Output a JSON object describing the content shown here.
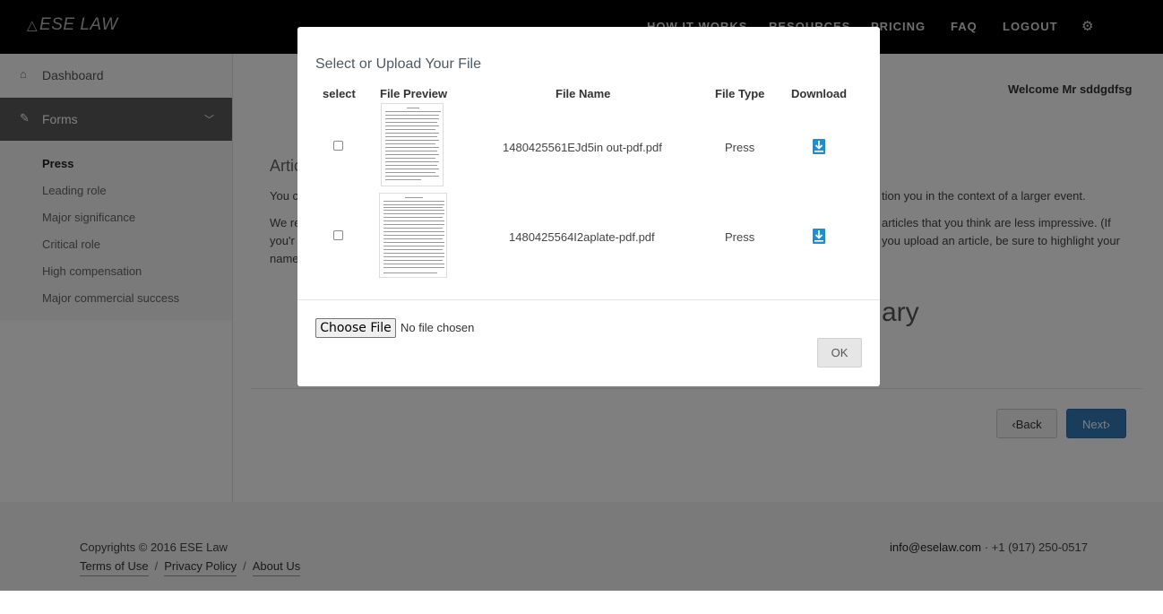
{
  "header": {
    "logo": "ESE LAW",
    "nav": [
      {
        "label": "HOW IT WORKS"
      },
      {
        "label": "RESOURCES"
      },
      {
        "label": "PRICING"
      },
      {
        "label": "FAQ"
      },
      {
        "label": "LOGOUT"
      }
    ],
    "settings_icon": "gears-icon"
  },
  "sidebar": {
    "dashboard": "Dashboard",
    "forms": "Forms",
    "sub_items": [
      {
        "label": "Press",
        "active": true
      },
      {
        "label": "Leading role"
      },
      {
        "label": "Major significance"
      },
      {
        "label": "Critical role"
      },
      {
        "label": "High compensation"
      },
      {
        "label": "Major commercial success"
      }
    ]
  },
  "main": {
    "welcome": "Welcome Mr sddgdfsg",
    "section_title": "Artic",
    "text_line1_left": "You c",
    "text_line1_right": "tion you in the context of a larger event.",
    "text_line2_left": "We re",
    "text_line2_right": "articles that you think are less impressive. (If",
    "text_line3_left": "you'r",
    "text_line3_right": "you upload an article, be sure to highlight your",
    "text_line4_left": "name",
    "big_text": "ary",
    "back_label": "Back",
    "next_label": "Next"
  },
  "footer": {
    "copyright": "Copyrights © 2016 ESE Law",
    "links": [
      "Terms of Use",
      "Privacy Policy",
      "About Us"
    ],
    "email": "info@eselaw.com",
    "phone": " · +1 (917) 250-0517"
  },
  "modal": {
    "title": "Select or Upload Your File",
    "columns": [
      "select",
      "File Preview",
      "File Name",
      "File Type",
      "Download"
    ],
    "rows": [
      {
        "file_name": "1480425561EJd5in out-pdf.pdf",
        "file_type": "Press",
        "selected": false
      },
      {
        "file_name": "1480425564I2aplate-pdf.pdf",
        "file_type": "Press",
        "selected": false
      }
    ],
    "choose_file_label": "Choose File",
    "no_file_label": "No file chosen",
    "ok_label": "OK"
  },
  "colors": {
    "accent": "#337ab7",
    "download_icon": "#1a8fd6",
    "active_menu": "#5a5a5a"
  }
}
